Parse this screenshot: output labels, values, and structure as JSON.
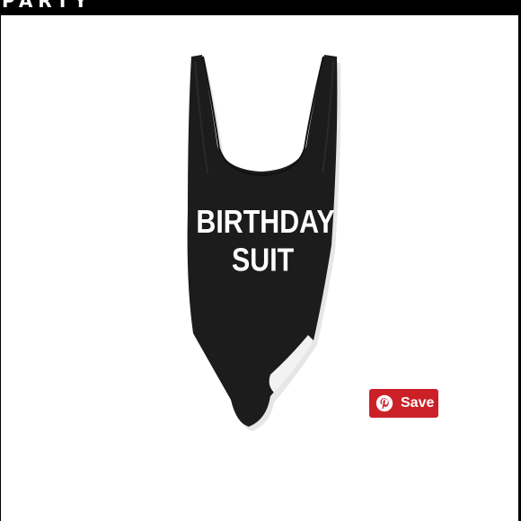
{
  "header": {
    "partial_title": "PARTY"
  },
  "product": {
    "print_line_1": "BIRTHDAY",
    "print_line_2": "SUIT",
    "garment_color": "#1c1c1c",
    "print_color": "#ffffff"
  },
  "pinterest": {
    "save_label": "Save",
    "icon": "pinterest-icon",
    "brand_color": "#cb2027"
  }
}
